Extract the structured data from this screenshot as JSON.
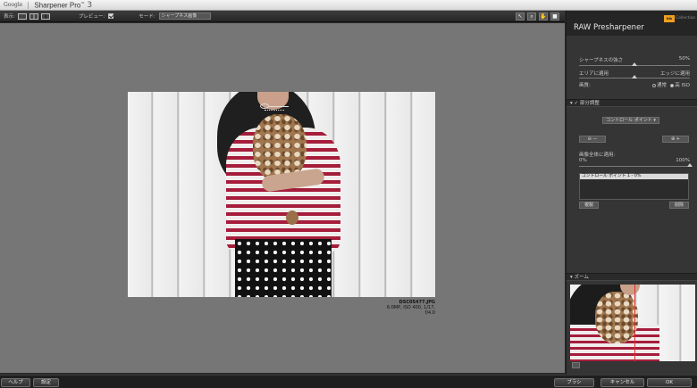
{
  "titlebar": {
    "brand": "Google",
    "app_name": "Sharpener Pro",
    "trademark": "™",
    "version": "3"
  },
  "toolbar": {
    "view_label": "表示:",
    "preview_label": "プレビュー:",
    "preview_checked": true,
    "mode_label": "モード:",
    "mode_value": "シャープネス画像"
  },
  "file": {
    "name": "DSC05477.JPG",
    "details": "6.0MP, ISO 400, 1/17, f/4.0"
  },
  "panel": {
    "title": "RAW Presharpener",
    "logo_text": "Nik",
    "logo_sub": "Collection",
    "sharpness_label": "シャープネスの強さ",
    "sharpness_value": "50%",
    "sharpness_fraction": 0.5,
    "apply_areas_label": "エリアに適用",
    "apply_edges_label": "エッジに適用",
    "area_edge_fraction": 0.5,
    "quality_label": "画質:",
    "quality_normal": "通常",
    "quality_high": "高 ISO",
    "quality_selected": "高 ISO",
    "selective_section": "部分調整",
    "selective_checked": true,
    "control_point_dropdown": "コントロール ポイント",
    "apply_whole_label": "画像全体に適用:",
    "apply_whole_min": "0%",
    "apply_whole_max": "100%",
    "apply_whole_fraction": 1.0,
    "list_item": "コントロール ポイント 1 - 0%",
    "duplicate_label": "複製",
    "delete_label": "削除",
    "zoom_section": "ズーム"
  },
  "bottom": {
    "help_label": "ヘルプ",
    "settings_label": "設定",
    "brush_label": "ブラシ",
    "cancel_label": "キャンセル",
    "ok_label": "OK"
  },
  "colors": {
    "canvas_bg": "#767676",
    "panel_bg": "#353535",
    "stripe_red": "#a51d3a",
    "logo_orange": "#f0a020"
  }
}
